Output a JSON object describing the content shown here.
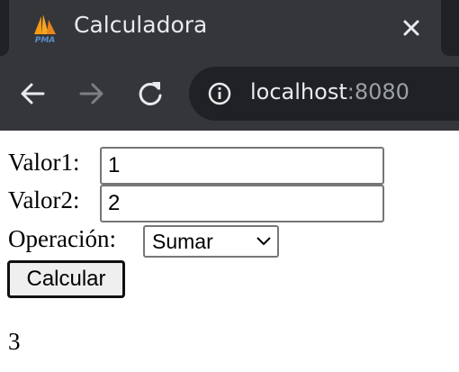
{
  "browser": {
    "tab_title": "Calculadora",
    "favicon_text": "PMA",
    "url_host": "localhost",
    "url_port": ":8080"
  },
  "form": {
    "valor1_label": "Valor1:",
    "valor1_value": "1",
    "valor2_label": "Valor2:",
    "valor2_value": "2",
    "operacion_label": "Operación:",
    "operacion_selected": "Sumar",
    "submit_label": "Calcular"
  },
  "result": "3",
  "colors": {
    "tabstrip_bg": "#202124",
    "toolbar_bg": "#35363a",
    "omnibox_bg": "#202124",
    "favicon_orange": "#f89c0e",
    "favicon_blue": "#5b8ec9"
  }
}
